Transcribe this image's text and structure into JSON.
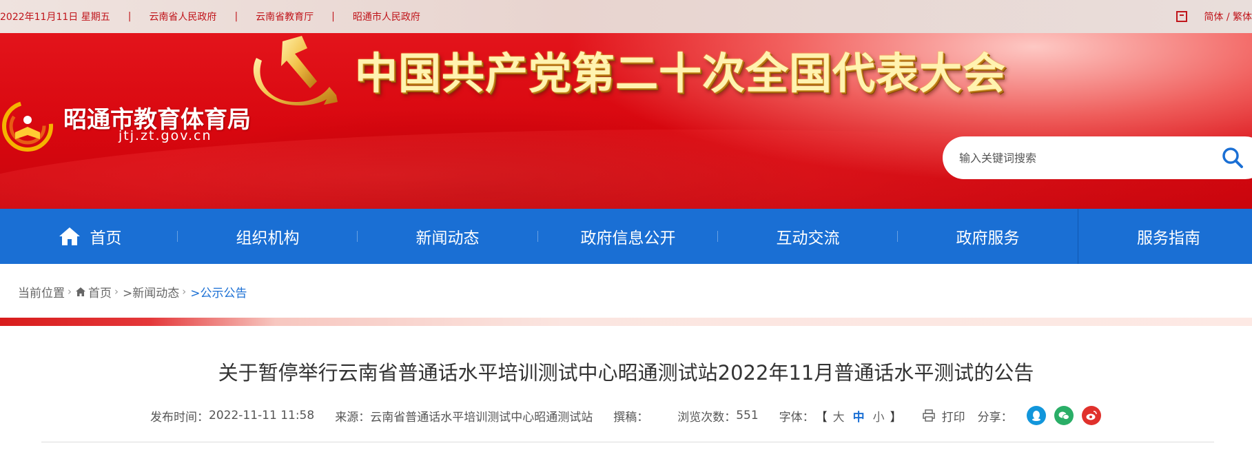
{
  "topbar": {
    "date": "2022年11月11日 星期五",
    "sep": "|",
    "links": [
      "云南省人民政府",
      "云南省教育厅",
      "昭通市人民政府"
    ],
    "lang": "简体 / 繁体"
  },
  "banner": {
    "headline": "中国共产党第二十次全国代表大会",
    "site_name": "昭通市教育体育局",
    "site_url": "jtj.zt.gov.cn",
    "search_placeholder": "输入关键词搜索"
  },
  "nav": {
    "items": [
      "首页",
      "组织机构",
      "新闻动态",
      "政府信息公开",
      "互动交流",
      "政府服务",
      "服务指南"
    ]
  },
  "breadcrumb": {
    "label": "当前位置",
    "home": "首页",
    "level1": ">新闻动态",
    "current": ">公示公告"
  },
  "article": {
    "title": "关于暂停举行云南省普通话水平培训测试中心昭通测试站2022年11月普通话水平测试的公告",
    "publish_label": "发布时间：",
    "publish_time": "2022-11-11 11:58",
    "source_label": "来源：",
    "source": "云南省普通话水平培训测试中心昭通测试站",
    "author_label": "撰稿：",
    "views_label": "浏览次数：",
    "views": "551",
    "font_label": "字体：",
    "bracket_open": "【",
    "font_large": "大",
    "font_medium": "中",
    "font_small": "小",
    "bracket_close": "】",
    "print": "打印",
    "share_label": "分享：",
    "share_icons": [
      "qq-icon",
      "wechat-icon",
      "weibo-icon"
    ]
  },
  "colors": {
    "nav_blue": "#1a6fd4",
    "banner_red": "#d8070f",
    "link_red": "#c0151b",
    "qq": "#1296db",
    "wechat": "#2aae67",
    "weibo": "#e0312c"
  }
}
